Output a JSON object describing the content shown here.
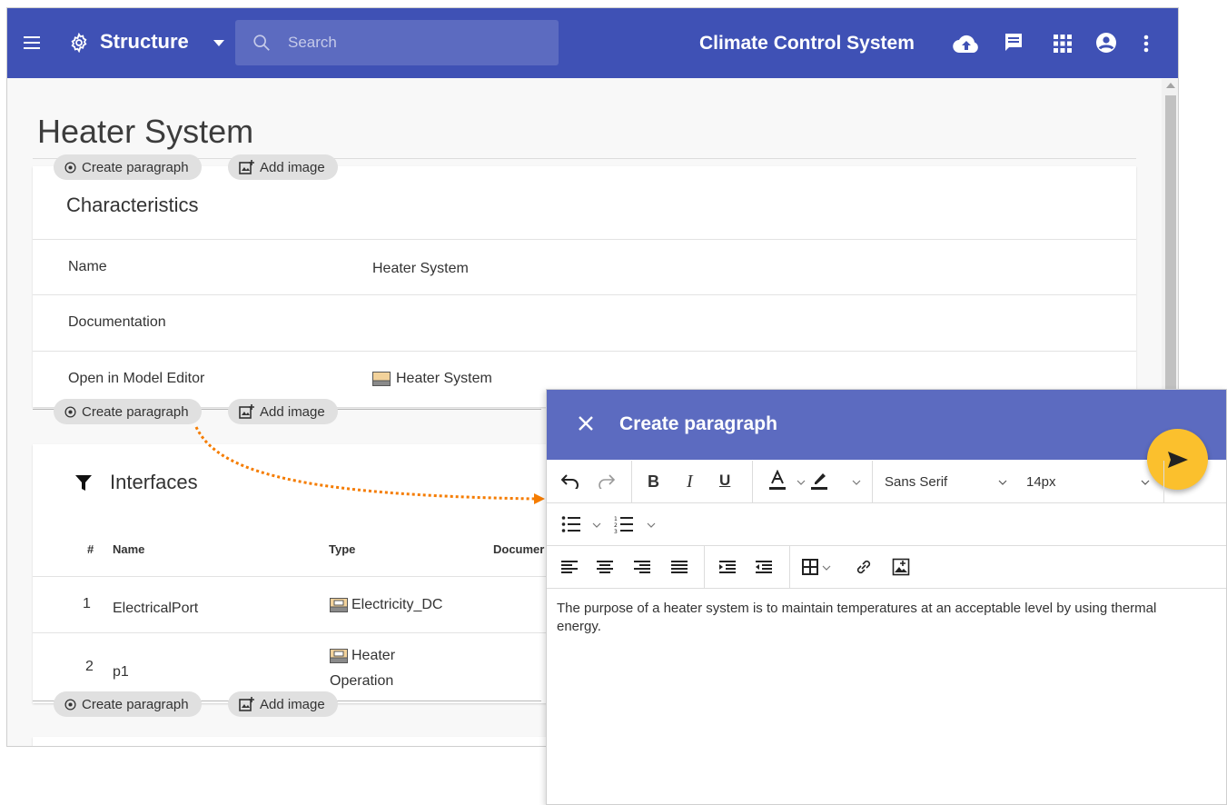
{
  "topbar": {
    "project_name": "Structure",
    "search_placeholder": "Search",
    "system_title": "Climate Control System"
  },
  "page": {
    "title": "Heater System"
  },
  "chips": {
    "create_paragraph": "Create paragraph",
    "add_image": "Add image"
  },
  "characteristics": {
    "title": "Characteristics",
    "rows": [
      {
        "label": "Name",
        "value": "Heater System"
      },
      {
        "label": "Documentation",
        "value": ""
      },
      {
        "label": "Open in Model Editor",
        "value": "Heater System"
      }
    ]
  },
  "interfaces": {
    "title": "Interfaces",
    "columns": [
      "#",
      "Name",
      "Type",
      "Documer"
    ],
    "rows": [
      {
        "num": "1",
        "name": "ElectricalPort",
        "type": "Electricity_DC"
      },
      {
        "num": "2",
        "name": "p1",
        "type_line1": "Heater",
        "type_line2": "Operation"
      }
    ]
  },
  "dialog": {
    "title": "Create paragraph",
    "font": "Sans Serif",
    "size": "14px",
    "body": "The purpose of a heater system is to maintain temperatures at an acceptable level by using thermal energy."
  },
  "colors": {
    "topbar": "#3f51b5",
    "dialog_header": "#5c6bc0",
    "send_button": "#fbc02d",
    "connector": "#f57c00"
  }
}
